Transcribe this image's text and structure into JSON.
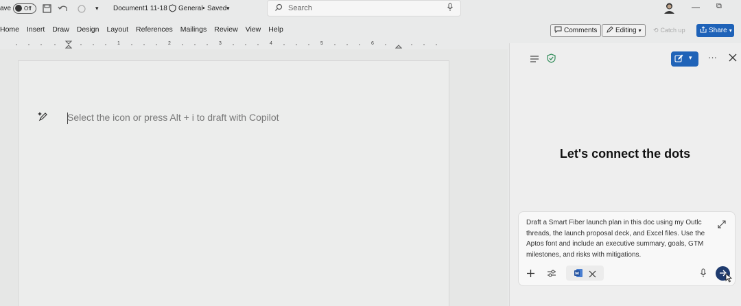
{
  "titlebar": {
    "autosave_label": "ave",
    "autosave_state": "Off",
    "document_name": "Document1 11-18",
    "sensitivity": "General",
    "save_status": "Saved",
    "search_placeholder": "Search"
  },
  "menu": [
    "Home",
    "Insert",
    "Draw",
    "Design",
    "Layout",
    "References",
    "Mailings",
    "Review",
    "View",
    "Help"
  ],
  "ribbon_right": {
    "comments": "Comments",
    "editing": "Editing",
    "catchup": "Catch up",
    "share": "Share"
  },
  "ruler": [
    "1",
    "2",
    "3",
    "4",
    "5",
    "6"
  ],
  "document": {
    "hint": "Select the icon or press Alt + i to draft with Copilot"
  },
  "copilot": {
    "heading": "Let's connect the dots",
    "prompt": "Draft a Smart Fiber launch plan in this doc using my Outlc threads, the launch proposal deck, and Excel files. Use the Aptos font and include an executive summary, goals, GTM milestones, and risks with mitigations."
  },
  "colors": {
    "accent": "#1e62b8",
    "send": "#1f3b6e",
    "shield": "#2e8b57"
  }
}
